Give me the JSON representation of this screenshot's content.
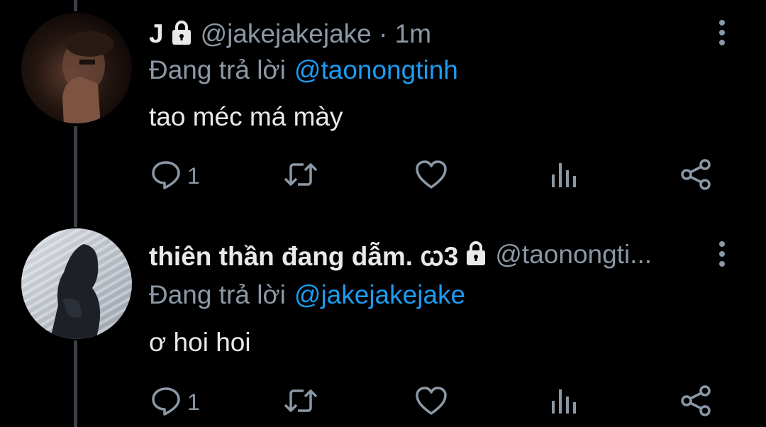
{
  "tweets": [
    {
      "name": "J",
      "handle": "@jakejakejake · 1m",
      "reply_prefix": "Đang trả lời",
      "reply_to": "@taonongtinh",
      "text": "tao méc má mày",
      "reply_count": "1"
    },
    {
      "name": "thiên thần đang dẫm. ꞷ3",
      "handle": "@taonongti...",
      "reply_prefix": "Đang trả lời",
      "reply_to": "@jakejakejake",
      "text": "ơ hoi hoi",
      "reply_count": "1"
    }
  ],
  "colors": {
    "background": "#000000",
    "text": "#e7e9ea",
    "secondary": "#8b98a5",
    "accent": "#1d9bf0",
    "thread_line": "#3a3f44"
  },
  "icons": [
    "lock-icon",
    "more-icon",
    "reply-icon",
    "retweet-icon",
    "like-icon",
    "analytics-icon",
    "share-icon"
  ]
}
